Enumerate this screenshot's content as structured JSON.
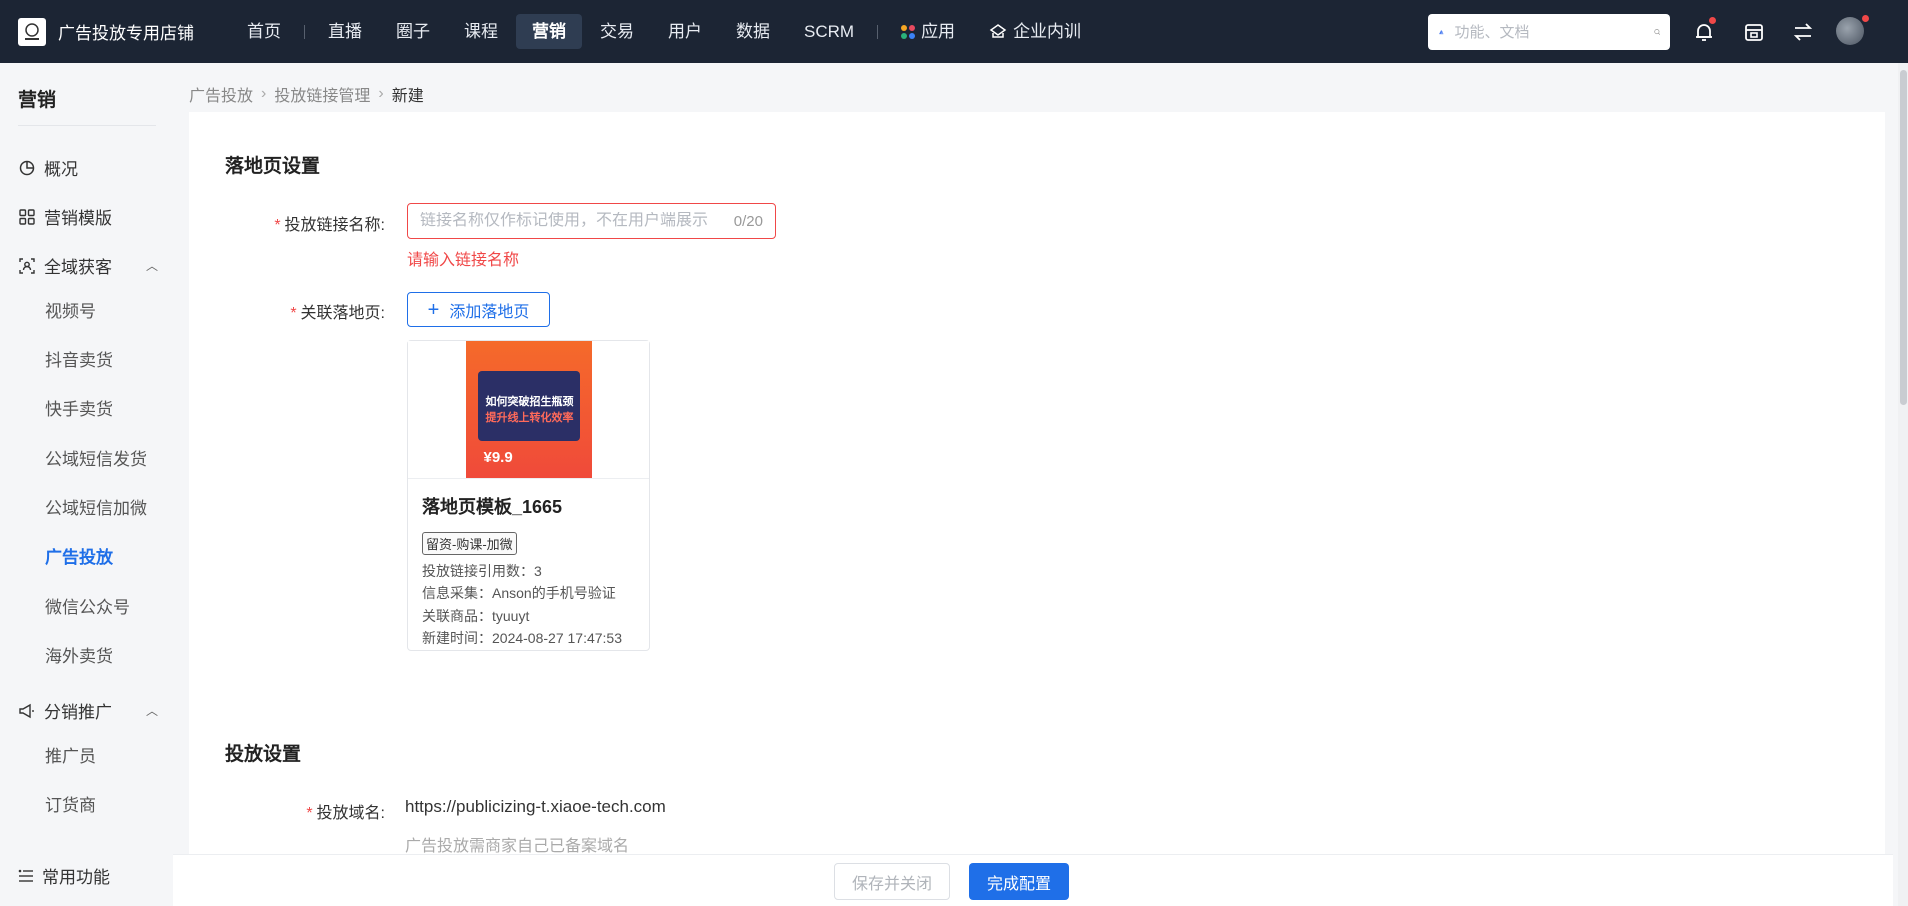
{
  "brand": {
    "name": "广告投放专用店铺"
  },
  "nav": {
    "items": [
      {
        "label": "首页"
      },
      {
        "label": "直播"
      },
      {
        "label": "圈子"
      },
      {
        "label": "课程"
      },
      {
        "label": "营销",
        "active": true
      },
      {
        "label": "交易"
      },
      {
        "label": "用户"
      },
      {
        "label": "数据"
      },
      {
        "label": "SCRM"
      }
    ],
    "apps_label": "应用",
    "training_label": "企业内训"
  },
  "search": {
    "placeholder": "功能、文档"
  },
  "sidebar": {
    "title": "营销",
    "items": {
      "overview": "概况",
      "templates": "营销模版",
      "acquisition": "全域获客",
      "distribution": "分销推广"
    },
    "acquisition_subs": [
      "视频号",
      "抖音卖货",
      "快手卖货",
      "公域短信发货",
      "公域短信加微",
      "广告投放",
      "微信公众号",
      "海外卖货"
    ],
    "distribution_subs": [
      "推广员",
      "订货商"
    ],
    "footer": "常用功能"
  },
  "breadcrumb": {
    "level1": "广告投放",
    "level2": "投放链接管理",
    "current": "新建"
  },
  "landing": {
    "section_title": "落地页设置",
    "name_label": "投放链接名称:",
    "name_placeholder": "链接名称仅作标记使用，不在用户端展示",
    "name_count": "0/20",
    "name_error": "请输入链接名称",
    "page_label": "关联落地页:",
    "add_button": "添加落地页",
    "card": {
      "title": "落地页模板_1665",
      "tag": "留资-购课-加微",
      "ref_count": "投放链接引用数：3",
      "info_collect": "信息采集：Anson的手机号验证",
      "product": "关联商品：tyuuyt",
      "created": "新建时间：2024-08-27 17:47:53",
      "poster_line1": "如何突破招生瓶颈",
      "poster_line2": "提升线上转化效率",
      "poster_price": "¥9.9"
    }
  },
  "delivery": {
    "section_title": "投放设置",
    "domain_label": "投放域名:",
    "domain_value": "https://publicizing-t.xiaoe-tech.com",
    "domain_hint": "广告投放需商家自己已备案域名"
  },
  "footer": {
    "save_close": "保存并关闭",
    "done": "完成配置"
  },
  "colors": {
    "accent": "#1f6fe8",
    "error": "#f04848",
    "topbar": "#1c2534"
  }
}
